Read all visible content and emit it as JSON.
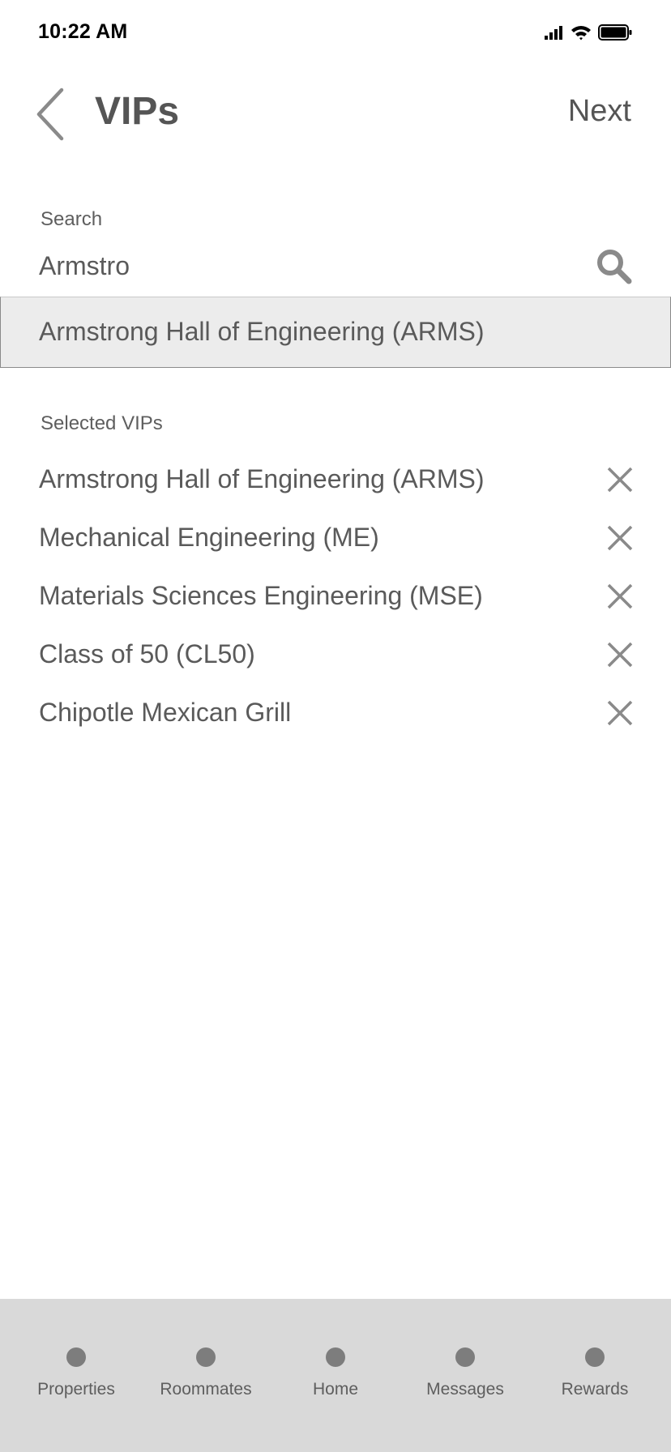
{
  "status_bar": {
    "time": "10:22 AM"
  },
  "header": {
    "title": "VIPs",
    "next_label": "Next"
  },
  "search": {
    "label": "Search",
    "value": "Armstro"
  },
  "suggestion": {
    "label": "Armstrong Hall of Engineering (ARMS)"
  },
  "selected": {
    "label": "Selected VIPs",
    "items": [
      {
        "label": "Armstrong Hall of Engineering (ARMS)"
      },
      {
        "label": "Mechanical Engineering (ME)"
      },
      {
        "label": "Materials Sciences Engineering (MSE)"
      },
      {
        "label": "Class of 50 (CL50)"
      },
      {
        "label": "Chipotle Mexican Grill"
      }
    ]
  },
  "tab_bar": {
    "tabs": [
      {
        "label": "Properties"
      },
      {
        "label": "Roommates"
      },
      {
        "label": "Home"
      },
      {
        "label": "Messages"
      },
      {
        "label": "Rewards"
      }
    ]
  },
  "icons": {
    "back": "chevron-left-icon",
    "search": "magnifier-icon",
    "remove": "close-icon",
    "signal": "signal-icon",
    "wifi": "wifi-icon",
    "battery": "battery-icon"
  },
  "colors": {
    "text": "#5a5a5a",
    "icon": "#8a8a8a",
    "suggestion_bg": "#ececec",
    "tab_bar_bg": "#d9d9d9",
    "tab_dot": "#7d7d7d"
  }
}
